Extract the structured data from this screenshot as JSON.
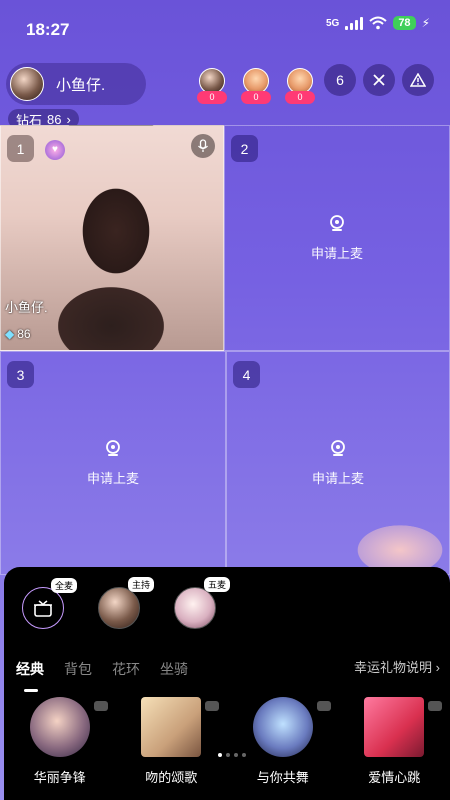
{
  "status_bar": {
    "time": "18:27",
    "network": "5G",
    "battery": "78"
  },
  "host": {
    "name": "小鱼仔.",
    "diamond_label": "钻石",
    "diamond_count": "86"
  },
  "viewers": [
    {
      "count": "0"
    },
    {
      "count": "0"
    },
    {
      "count": "0"
    }
  ],
  "online_count": "6",
  "seats": [
    {
      "number": "1",
      "user": "小鱼仔.",
      "gems": "86"
    },
    {
      "number": "2",
      "action": "申请上麦"
    },
    {
      "number": "3",
      "action": "申请上麦"
    },
    {
      "number": "4",
      "action": "申请上麦"
    }
  ],
  "gift_panel": {
    "targets": [
      {
        "tag": "全麦"
      },
      {
        "tag": "主持"
      },
      {
        "tag": "五麦"
      }
    ],
    "tabs": [
      "经典",
      "背包",
      "花环",
      "坐骑"
    ],
    "lucky_gift_info": "幸运礼物说明",
    "gifts": [
      {
        "name": "华丽争锋"
      },
      {
        "name": "吻的颂歌"
      },
      {
        "name": "与你共舞"
      },
      {
        "name": "爱情心跳"
      }
    ]
  }
}
